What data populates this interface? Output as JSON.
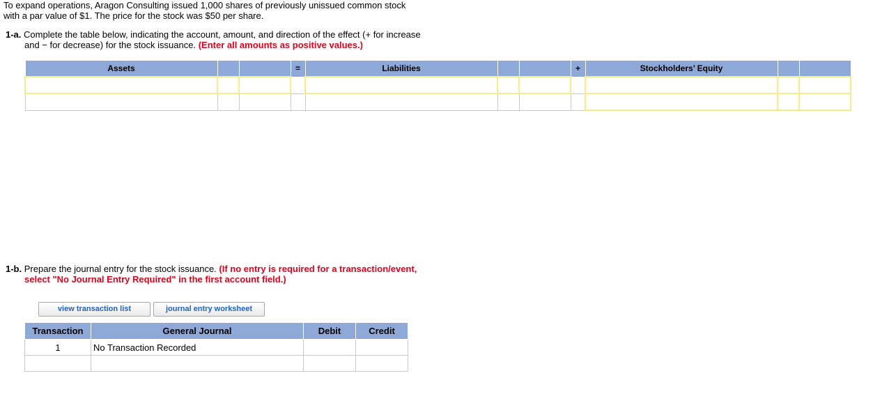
{
  "problem": {
    "text_line1": "To expand operations, Aragon Consulting issued 1,000 shares of previously unissued common stock",
    "text_line2": "with a par value of $1. The price for the stock was $50 per share."
  },
  "part_a": {
    "number": "1-a.",
    "line1": "Complete the table below, indicating the account, amount, and direction of the effect (+ for increase",
    "line2_plain": "and − for decrease) for the stock issuance.",
    "line2_red": "(Enter all amounts as positive values.)"
  },
  "equation_table": {
    "headers": {
      "assets": "Assets",
      "equals": "=",
      "liabilities": "Liabilities",
      "plus": "+",
      "equity": "Stockholders’ Equity"
    }
  },
  "part_b": {
    "number": "1-b.",
    "line1_plain": "Prepare the journal entry for the stock issuance.",
    "line1_red": "(If no entry is required for a transaction/event,",
    "line2_red": "select \"No Journal Entry Required\" in the first account field.)"
  },
  "buttons": {
    "view_transaction_list": "view transaction list",
    "journal_entry_worksheet": "journal entry worksheet"
  },
  "journal_table": {
    "headers": {
      "transaction": "Transaction",
      "general_journal": "General Journal",
      "debit": "Debit",
      "credit": "Credit"
    },
    "rows": [
      {
        "transaction": "1",
        "account": "No Transaction Recorded",
        "debit": "",
        "credit": ""
      },
      {
        "transaction": "",
        "account": "",
        "debit": "",
        "credit": ""
      }
    ]
  }
}
